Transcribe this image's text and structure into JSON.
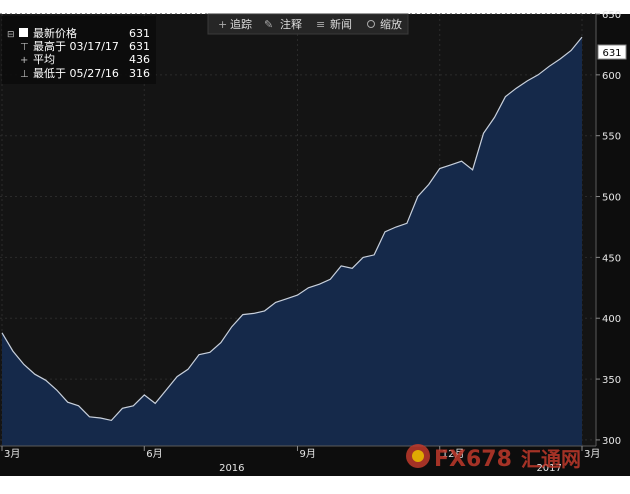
{
  "toolbar": {
    "items": [
      {
        "icon": "plus-icon",
        "label": "追踪"
      },
      {
        "icon": "pencil-icon",
        "label": "注释"
      },
      {
        "icon": "news-icon",
        "label": "新闻"
      },
      {
        "icon": "magnifier-icon",
        "label": "缩放"
      }
    ]
  },
  "legend": {
    "rows": [
      {
        "label": "最新价格",
        "value": "631"
      },
      {
        "label": "最高于 03/17/17",
        "value": "631"
      },
      {
        "label": "平均",
        "value": "436"
      },
      {
        "label": "最低于 05/27/16",
        "value": "316"
      }
    ]
  },
  "last_price_tag": "631",
  "watermark": {
    "brand": "FX678",
    "cn": "汇通网"
  },
  "colors": {
    "plot_bg": "#141414",
    "area_fill": "#15294a",
    "line": "#c8d0dc",
    "axis_text": "#e6e6e6",
    "toolbar_bg": "#262626"
  },
  "chart_data": {
    "type": "area",
    "title": "",
    "xlabel": "",
    "ylabel": "",
    "ylim": [
      295,
      650
    ],
    "y_ticks": [
      300,
      350,
      400,
      450,
      500,
      550,
      600,
      650
    ],
    "x_ticks": [
      {
        "label": "3月",
        "pos": 0
      },
      {
        "label": "6月",
        "pos": 13
      },
      {
        "label": "9月",
        "pos": 27
      },
      {
        "label": "12月",
        "pos": 40
      },
      {
        "label": "3月",
        "pos": 53
      }
    ],
    "x_year_labels": [
      {
        "label": "2016",
        "pos": 21
      },
      {
        "label": "2017",
        "pos": 50
      }
    ],
    "values": [
      388,
      373,
      362,
      354,
      349,
      341,
      331,
      328,
      319,
      318,
      316,
      326,
      328,
      337,
      330,
      341,
      352,
      358,
      370,
      372,
      380,
      393,
      403,
      404,
      406,
      413,
      416,
      419,
      425,
      428,
      432,
      443,
      441,
      450,
      452,
      471,
      475,
      478,
      500,
      510,
      523,
      526,
      529,
      522,
      552,
      565,
      582,
      589,
      595,
      600,
      607,
      613,
      620,
      631
    ]
  }
}
